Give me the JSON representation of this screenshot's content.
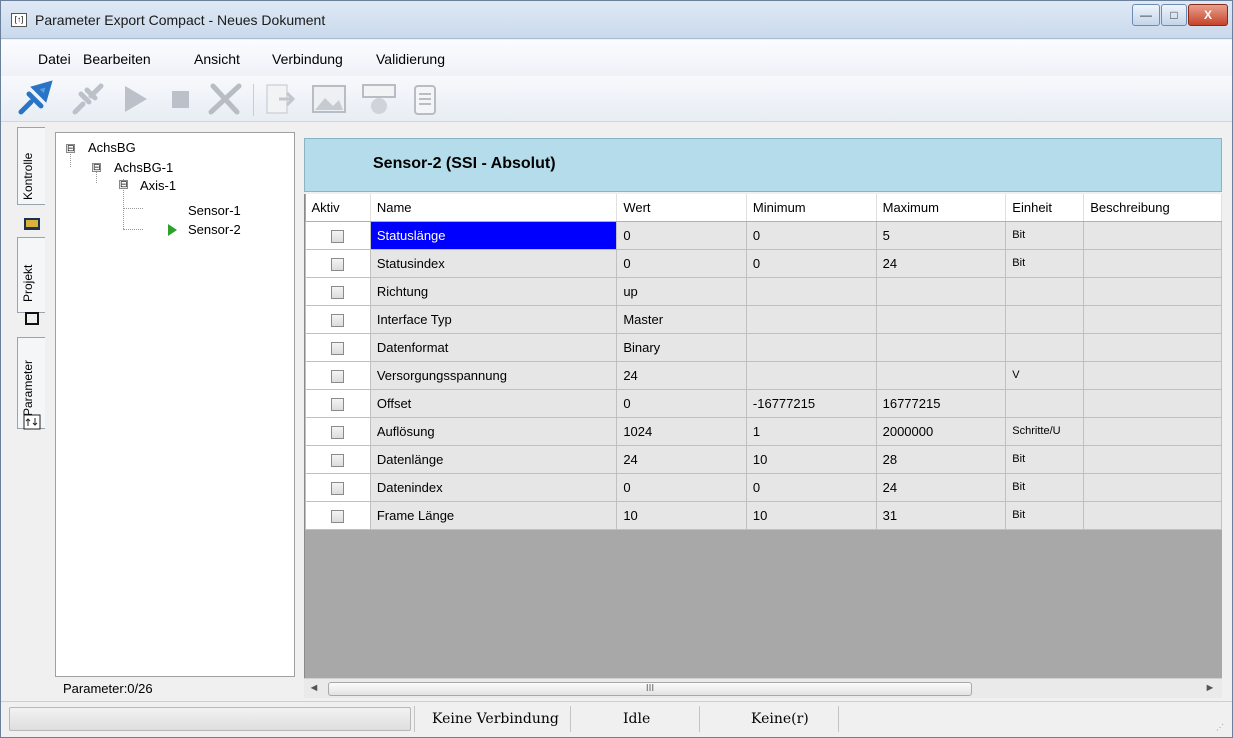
{
  "window": {
    "title": "Parameter Export Compact - Neues Dokument",
    "app_icon_glyph": "[↑]",
    "minimize_glyph": "—",
    "maximize_glyph": "□",
    "close_glyph": "X"
  },
  "menu": [
    {
      "label": "Datei"
    },
    {
      "label": "Bearbeiten"
    },
    {
      "label": "Ansicht"
    },
    {
      "label": "Verbindung"
    },
    {
      "label": "Validierung"
    }
  ],
  "toolbar": {
    "icons": [
      "connect-icon",
      "disconnect-icon",
      "play-icon",
      "stop-icon",
      "tools-icon",
      "export-icon",
      "image-icon",
      "device-icon",
      "clipboard-icon"
    ]
  },
  "side_tabs": [
    {
      "label": "Kontrolle",
      "icon": "monitor-icon"
    },
    {
      "label": "Projekt",
      "icon": "cube-icon"
    },
    {
      "label": "Parameter",
      "icon": "parameter-icon"
    }
  ],
  "tree": {
    "nodes": [
      {
        "label": "AchsBG",
        "expander": "⊟"
      },
      {
        "label": "AchsBG-1",
        "expander": "⊟"
      },
      {
        "label": "Axis-1",
        "expander": "⊟"
      },
      {
        "label": "Sensor-1"
      },
      {
        "label": "Sensor-2",
        "selected": true
      }
    ],
    "param_count": "Parameter:0/26"
  },
  "detail": {
    "heading": "Sensor-2 (SSI - Absolut)",
    "columns": [
      "Aktiv",
      "Name",
      "Wert",
      "Minimum",
      "Maximum",
      "Einheit",
      "Beschreibung"
    ],
    "rows": [
      {
        "name": "Statuslänge",
        "wert": "0",
        "min": "0",
        "max": "5",
        "unit": "Bit",
        "desc": "",
        "selected": true
      },
      {
        "name": "Statusindex",
        "wert": "0",
        "min": "0",
        "max": "24",
        "unit": "Bit",
        "desc": ""
      },
      {
        "name": "Richtung",
        "wert": "up",
        "min": "",
        "max": "",
        "unit": "",
        "desc": ""
      },
      {
        "name": "Interface Typ",
        "wert": "Master",
        "min": "",
        "max": "",
        "unit": "",
        "desc": ""
      },
      {
        "name": "Datenformat",
        "wert": "Binary",
        "min": "",
        "max": "",
        "unit": "",
        "desc": ""
      },
      {
        "name": "Versorgungsspannung",
        "wert": "24",
        "min": "",
        "max": "",
        "unit": "V",
        "desc": ""
      },
      {
        "name": "Offset",
        "wert": "0",
        "min": "-16777215",
        "max": "16777215",
        "unit": "",
        "desc": ""
      },
      {
        "name": "Auflösung",
        "wert": "1024",
        "min": "1",
        "max": "2000000",
        "unit": "Schritte/U",
        "desc": ""
      },
      {
        "name": "Datenlänge",
        "wert": "24",
        "min": "10",
        "max": "28",
        "unit": "Bit",
        "desc": ""
      },
      {
        "name": "Datenindex",
        "wert": "0",
        "min": "0",
        "max": "24",
        "unit": "Bit",
        "desc": ""
      },
      {
        "name": "Frame Länge",
        "wert": "10",
        "min": "10",
        "max": "31",
        "unit": "Bit",
        "desc": ""
      }
    ]
  },
  "scrollbar": {
    "left": "◄",
    "right": "►",
    "thumb_grip": "III"
  },
  "status": {
    "connection": "Keine Verbindung",
    "state": "Idle",
    "device": "Keine(r)"
  }
}
